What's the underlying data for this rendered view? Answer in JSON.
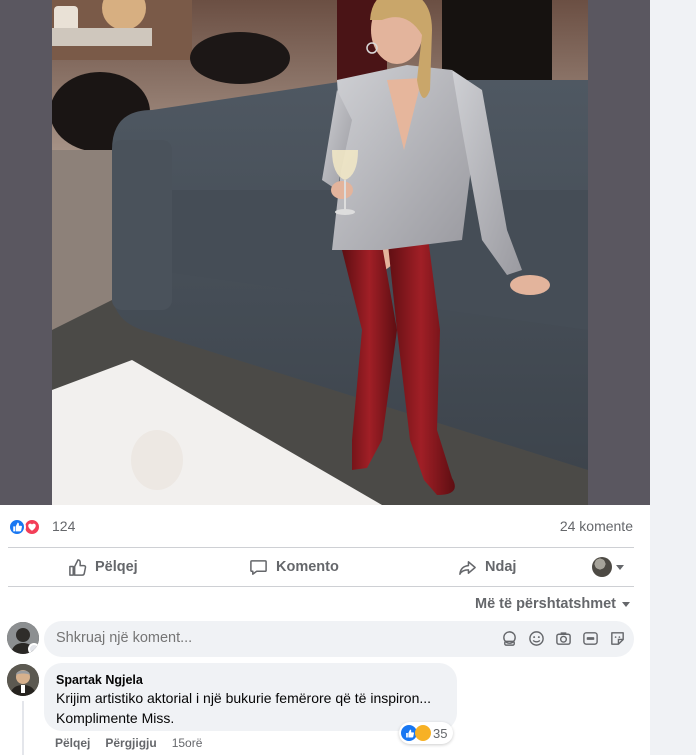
{
  "post": {
    "reaction_count": "124",
    "comment_count": "24 komente"
  },
  "actions": {
    "like_label": "Pëlqej",
    "comment_label": "Komento",
    "share_label": "Ndaj"
  },
  "sort": {
    "label": "Më të përshtatshmet"
  },
  "composer": {
    "placeholder": "Shkruaj një koment..."
  },
  "comments": [
    {
      "author": "Spartak Ngjela",
      "line1": "Krijim artistiko aktorial i një bukurie femërore që të inspiron...",
      "line2": "Komplimente Miss.",
      "reaction_count": "35",
      "like_label": "Pëlqej",
      "reply_label": "Përgjigju",
      "time": "15orë"
    }
  ],
  "colors": {
    "accent": "#1877f2",
    "love": "#f33e58",
    "muted_text": "#65676b",
    "bubble": "#f0f2f5"
  },
  "icons": {
    "like": "thumbs-up-icon",
    "comment": "speech-bubble-icon",
    "share": "share-arrow-icon",
    "sticker": "sticker-icon",
    "emoji": "smiley-icon",
    "camera": "camera-icon",
    "gif": "gif-icon",
    "avatar_sticker": "avatar-sticker-icon"
  }
}
